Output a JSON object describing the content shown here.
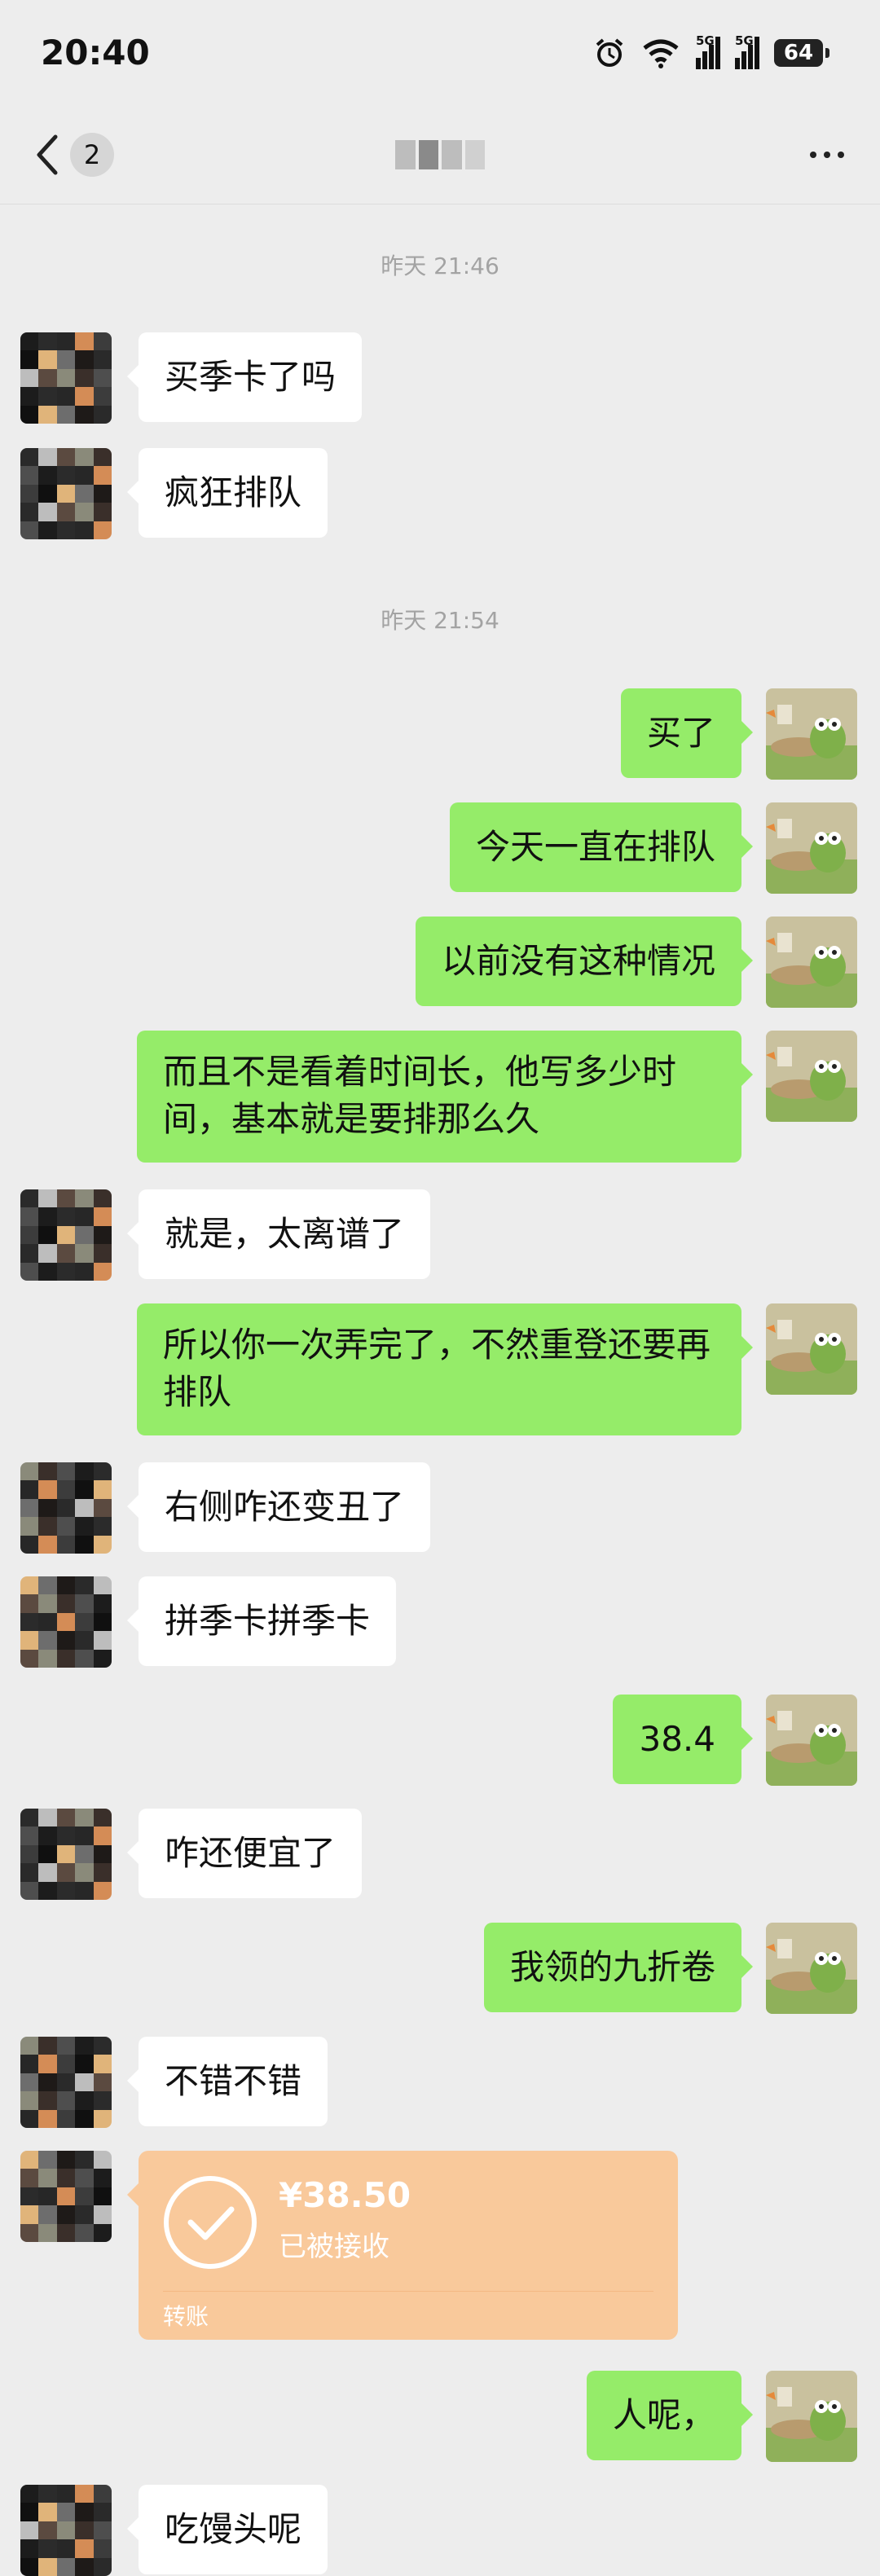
{
  "status_bar": {
    "time": "20:40",
    "alarm_icon": "alarm-clock-icon",
    "wifi_icon": "wifi-icon",
    "signal_1_label": "5G",
    "signal_2_label": "5G",
    "battery_level": "64"
  },
  "nav": {
    "back_icon": "chevron-left-icon",
    "unread_count": "2",
    "more_icon": "more-horizontal-icon"
  },
  "colors": {
    "background": "#ededed",
    "incoming_bubble": "#ffffff",
    "outgoing_bubble": "#95ec69",
    "transfer_card": "#f9c99b"
  },
  "chat": {
    "timestamps": [
      "昨天 21:46",
      "昨天 21:54"
    ],
    "messages": [
      {
        "side": "in",
        "text": "买季卡了吗"
      },
      {
        "side": "in",
        "text": "疯狂排队"
      },
      {
        "side": "out",
        "text": "买了"
      },
      {
        "side": "out",
        "text": "今天一直在排队"
      },
      {
        "side": "out",
        "text": "以前没有这种情况"
      },
      {
        "side": "out",
        "text": "而且不是看着时间长，他写多少时间，基本就是要排那么久"
      },
      {
        "side": "in",
        "text": "就是，太离谱了"
      },
      {
        "side": "out",
        "text": "所以你一次弄完了，不然重登还要再排队"
      },
      {
        "side": "in",
        "text": "右侧咋还变丑了"
      },
      {
        "side": "in",
        "text": "拼季卡拼季卡"
      },
      {
        "side": "out",
        "text": "38.4"
      },
      {
        "side": "in",
        "text": "咋还便宜了"
      },
      {
        "side": "out",
        "text": "我领的九折卷"
      },
      {
        "side": "in",
        "text": "不错不错"
      },
      {
        "side": "out",
        "text": "人呢，"
      },
      {
        "side": "in",
        "text": "吃馒头呢"
      }
    ],
    "transfer": {
      "amount": "¥38.50",
      "status": "已被接收",
      "label": "转账",
      "icon": "check-circle-icon"
    }
  }
}
